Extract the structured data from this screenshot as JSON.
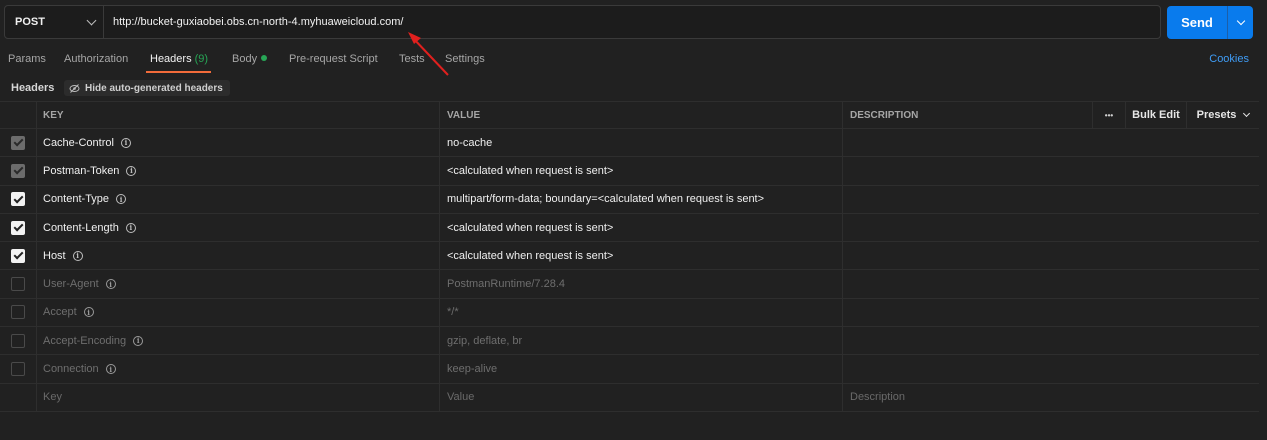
{
  "request": {
    "method": "POST",
    "url": "http://bucket-guxiaobei.obs.cn-north-4.myhuaweicloud.com/",
    "send_label": "Send"
  },
  "tabs": {
    "params": "Params",
    "authorization": "Authorization",
    "headers": "Headers",
    "headers_count": "(9)",
    "body": "Body",
    "prerequest": "Pre-request Script",
    "tests": "Tests",
    "settings": "Settings",
    "active": "headers"
  },
  "cookies": "Cookies",
  "headers_bar": {
    "title": "Headers",
    "hide_button": "Hide auto-generated headers"
  },
  "table": {
    "columns": {
      "key": "KEY",
      "value": "VALUE",
      "description": "DESCRIPTION"
    },
    "more": "•••",
    "bulk_edit": "Bulk Edit",
    "presets": "Presets",
    "rows": [
      {
        "key": "Cache-Control",
        "value": "no-cache",
        "state": "auto"
      },
      {
        "key": "Postman-Token",
        "value": "<calculated when request is sent>",
        "state": "auto"
      },
      {
        "key": "Content-Type",
        "value": "multipart/form-data; boundary=<calculated when request is sent>",
        "state": "on"
      },
      {
        "key": "Content-Length",
        "value": "<calculated when request is sent>",
        "state": "on"
      },
      {
        "key": "Host",
        "value": "<calculated when request is sent>",
        "state": "on"
      },
      {
        "key": "User-Agent",
        "value": "PostmanRuntime/7.28.4",
        "state": "off"
      },
      {
        "key": "Accept",
        "value": "*/*",
        "state": "off"
      },
      {
        "key": "Accept-Encoding",
        "value": "gzip, deflate, br",
        "state": "off"
      },
      {
        "key": "Connection",
        "value": "keep-alive",
        "state": "off"
      }
    ],
    "placeholder": {
      "key": "Key",
      "value": "Value",
      "description": "Description"
    }
  },
  "colors": {
    "send": "#097bed",
    "active_tab_underline": "#f26b3a",
    "annotation_arrow": "#e0201e",
    "body_dot": "#27a656"
  }
}
